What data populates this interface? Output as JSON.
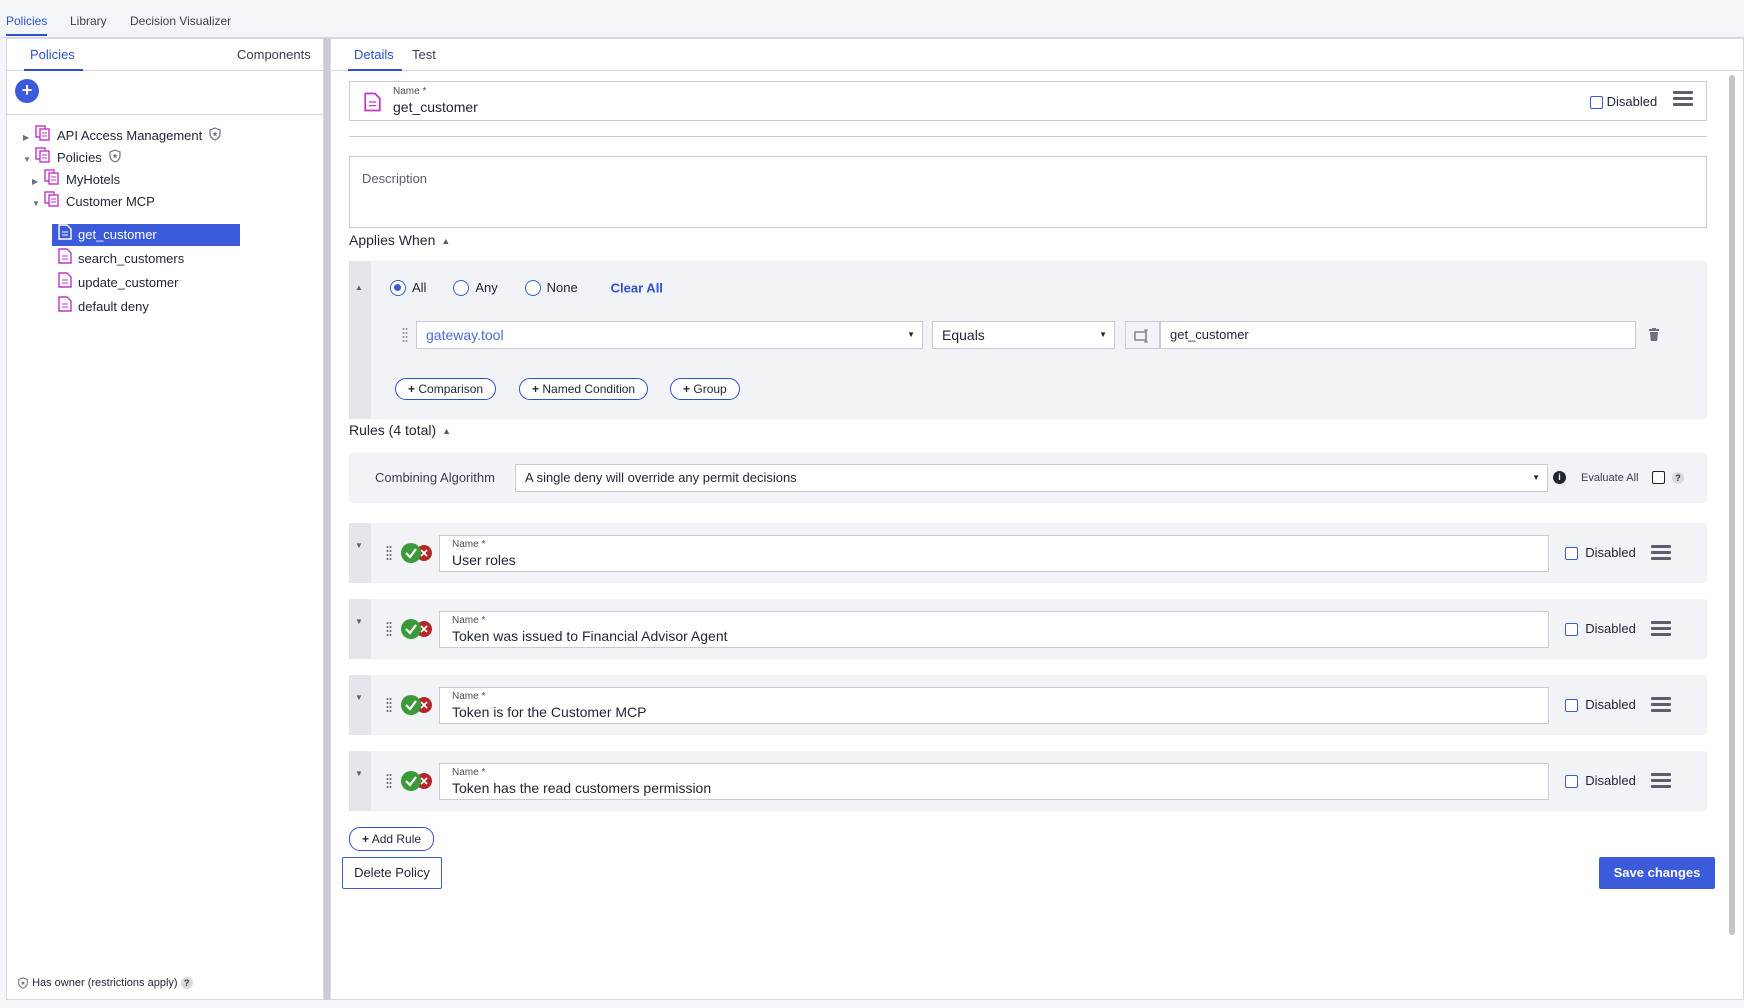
{
  "top_nav": {
    "tabs": [
      "Policies",
      "Library",
      "Decision Visualizer"
    ]
  },
  "left_panel": {
    "tabs": [
      "Policies",
      "Components"
    ],
    "add_icon": "plus-icon",
    "tree": [
      {
        "label": "API Access Management",
        "type": "policy-set",
        "expanded": false,
        "owner_shield": true
      },
      {
        "label": "Policies",
        "type": "policy-set",
        "expanded": true,
        "owner_shield": true
      },
      {
        "label": "MyHotels",
        "type": "policy-set",
        "expanded": false
      },
      {
        "label": "Customer MCP",
        "type": "policy-set",
        "expanded": true
      },
      {
        "label": "get_customer",
        "type": "policy",
        "selected": true
      },
      {
        "label": "search_customers",
        "type": "policy"
      },
      {
        "label": "update_customer",
        "type": "policy"
      },
      {
        "label": "default deny",
        "type": "policy"
      }
    ],
    "footer": {
      "text": "Has owner (restrictions apply)",
      "help": "?"
    }
  },
  "main": {
    "tabs": [
      "Details",
      "Test"
    ],
    "name": {
      "label": "Name",
      "required": "*",
      "value": "get_customer",
      "disabled_label": "Disabled"
    },
    "description": {
      "placeholder": "Description"
    },
    "applies_when": {
      "title": "Applies When",
      "options": [
        "All",
        "Any",
        "None"
      ],
      "selected": "All",
      "clear_all": "Clear All",
      "condition": {
        "attribute": "gateway.tool",
        "operator": "Equals",
        "value": "get_customer"
      },
      "buttons": [
        "Comparison",
        "Named Condition",
        "Group"
      ]
    },
    "rules": {
      "title": "Rules (4 total)",
      "combining_label": "Combining Algorithm",
      "combining_value": "A single deny will override any permit decisions",
      "evaluate_all": "Evaluate All",
      "evaluate_help": "?",
      "items": [
        {
          "label": "Name",
          "required": "*",
          "value": "User roles",
          "disabled_label": "Disabled"
        },
        {
          "label": "Name",
          "required": "*",
          "value": "Token was issued to Financial Advisor Agent",
          "disabled_label": "Disabled"
        },
        {
          "label": "Name",
          "required": "*",
          "value": "Token is for the Customer MCP",
          "disabled_label": "Disabled"
        },
        {
          "label": "Name",
          "required": "*",
          "value": "Token has the read customers permission",
          "disabled_label": "Disabled"
        }
      ],
      "add_rule": "Add Rule"
    },
    "delete_button": "Delete Policy",
    "save_button": "Save changes"
  },
  "colors": {
    "accent": "#3b5bdb",
    "policy_icon": "#c234c8",
    "permit": "#3a9a3a",
    "deny": "#b52828"
  }
}
